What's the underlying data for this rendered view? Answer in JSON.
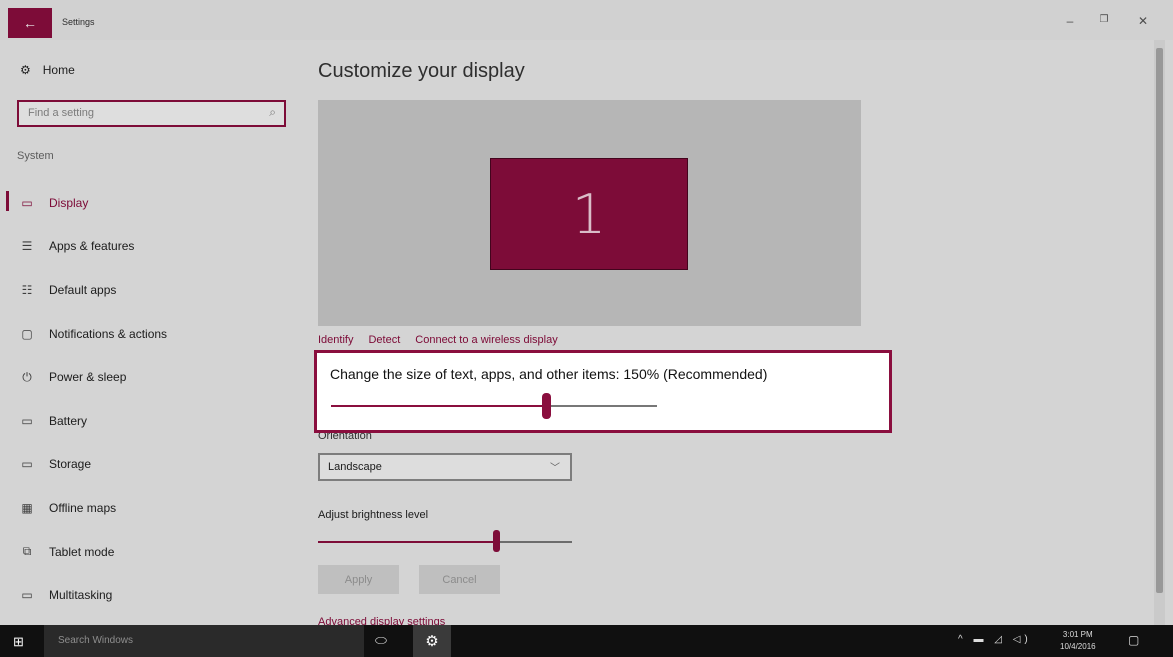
{
  "window": {
    "title": "Settings",
    "back_icon": "←",
    "minimize": "–",
    "maximize": "❐",
    "close": "✕"
  },
  "sidebar": {
    "home_label": "Home",
    "home_icon": "⚙",
    "search_placeholder": "Find a setting",
    "search_icon": "⌕",
    "section_title": "System",
    "items": [
      {
        "label": "Display",
        "icon": "▭",
        "selected": true
      },
      {
        "label": "Apps & features",
        "icon": "☰"
      },
      {
        "label": "Default apps",
        "icon": "☷"
      },
      {
        "label": "Notifications & actions",
        "icon": "▢"
      },
      {
        "label": "Power & sleep",
        "icon": "⏻"
      },
      {
        "label": "Battery",
        "icon": "▭"
      },
      {
        "label": "Storage",
        "icon": "▭"
      },
      {
        "label": "Offline maps",
        "icon": "▦"
      },
      {
        "label": "Tablet mode",
        "icon": "⧉"
      },
      {
        "label": "Multitasking",
        "icon": "▭"
      }
    ]
  },
  "main": {
    "title": "Customize your display",
    "monitor_number": "1",
    "links": [
      "Identify",
      "Detect",
      "Connect to a wireless display"
    ],
    "scale_label": "Change the size of text, apps, and other items: 150% (Recommended)",
    "scale_value_fraction": 0.66,
    "orientation_label": "Orientation",
    "orientation_value": "Landscape",
    "dropdown_icon": "﹀",
    "brightness_label": "Adjust brightness level",
    "brightness_value_fraction": 0.7,
    "apply_label": "Apply",
    "cancel_label": "Cancel",
    "advanced_link": "Advanced display settings"
  },
  "taskbar": {
    "start_icon": "⊞",
    "search_placeholder": "Search Windows",
    "task_view_icon": "⬭",
    "settings_icon": "⚙",
    "tray_icons": "^ ▬ ◿ ◁)",
    "time": "3:01 PM",
    "date": "10/4/2016",
    "notification_icon": "▢"
  },
  "colors": {
    "accent": "#8a0e3e"
  }
}
